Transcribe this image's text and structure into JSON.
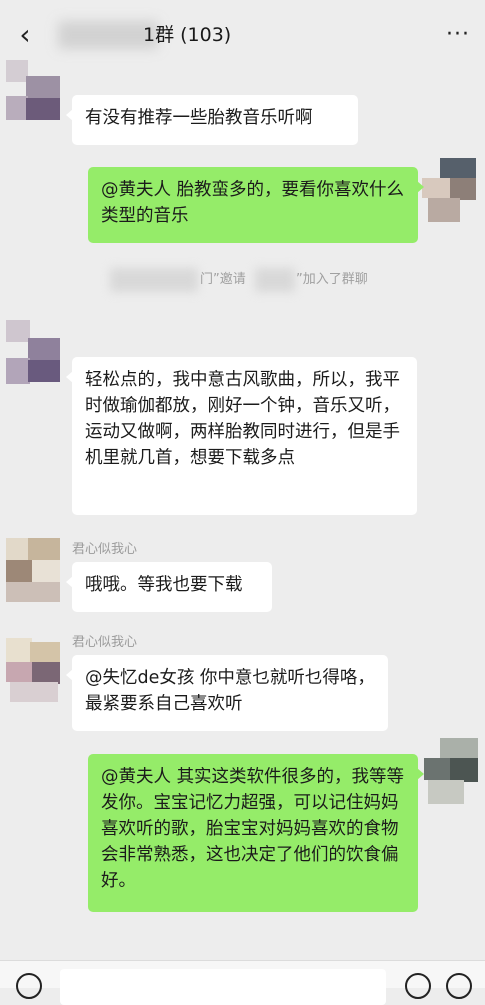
{
  "header": {
    "title": "1群 (103)",
    "back_icon": "chevron-left-icon",
    "more_icon": "more-dots-icon"
  },
  "system_notice": {
    "part1": "门”邀请",
    "part2": "”加入了群聊"
  },
  "messages": [
    {
      "side": "left",
      "sender": "",
      "text": "有没有推荐一些胎教音乐听啊"
    },
    {
      "side": "right",
      "sender": "",
      "text": "@黄夫人 胎教蛮多的，要看你喜欢什么类型的音乐"
    },
    {
      "side": "left",
      "sender": "",
      "text": "轻松点的，我中意古风歌曲，所以，我平时做瑜伽都放，刚好一个钟，音乐又听，运动又做啊，两样胎教同时进行，但是手机里就几首，想要下载多点"
    },
    {
      "side": "left",
      "sender": "君心似我心",
      "text": "哦哦。等我也要下载"
    },
    {
      "side": "left",
      "sender": "君心似我心",
      "text": "@失忆de女孩 你中意乜就听乜得咯，最紧要系自己喜欢听"
    },
    {
      "side": "right",
      "sender": "",
      "text": "@黄夫人 其实这类软件很多的，我等等发你。宝宝记忆力超强，可以记住妈妈喜欢听的歌，胎宝宝对妈妈喜欢的食物会非常熟悉，这也决定了他们的饮食偏好。"
    }
  ],
  "input_bar": {
    "voice_icon": "voice-icon",
    "emoji_icon": "emoji-icon",
    "plus_icon": "plus-icon"
  }
}
